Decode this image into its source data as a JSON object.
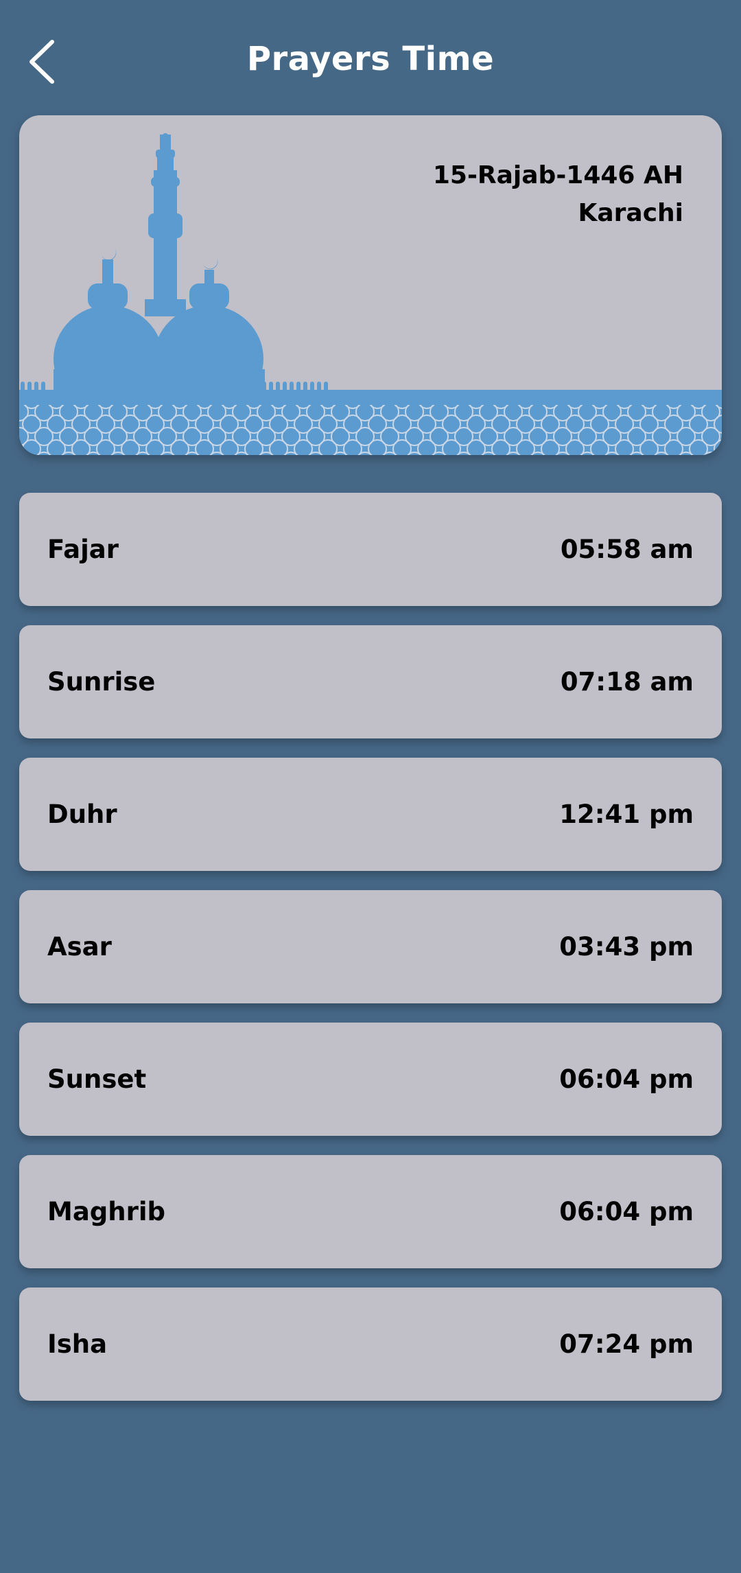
{
  "header": {
    "title": "Prayers Time",
    "back_icon": "chevron-left-icon"
  },
  "banner": {
    "hijri_date": "15-Rajab-1446 AH",
    "city": "Karachi",
    "illustration": "mosque-silhouette",
    "accent_color": "#5b9bcf",
    "card_color": "#c1bfc8"
  },
  "prayers": [
    {
      "name": "Fajar",
      "time": "05:58 am"
    },
    {
      "name": "Sunrise",
      "time": "07:18 am"
    },
    {
      "name": "Duhr",
      "time": "12:41 pm"
    },
    {
      "name": "Asar",
      "time": "03:43 pm"
    },
    {
      "name": "Sunset",
      "time": "06:04 pm"
    },
    {
      "name": "Maghrib",
      "time": "06:04 pm"
    },
    {
      "name": "Isha",
      "time": "07:24 pm"
    }
  ],
  "colors": {
    "background": "#466887",
    "text_on_card": "#000000",
    "title_text": "#ffffff"
  }
}
